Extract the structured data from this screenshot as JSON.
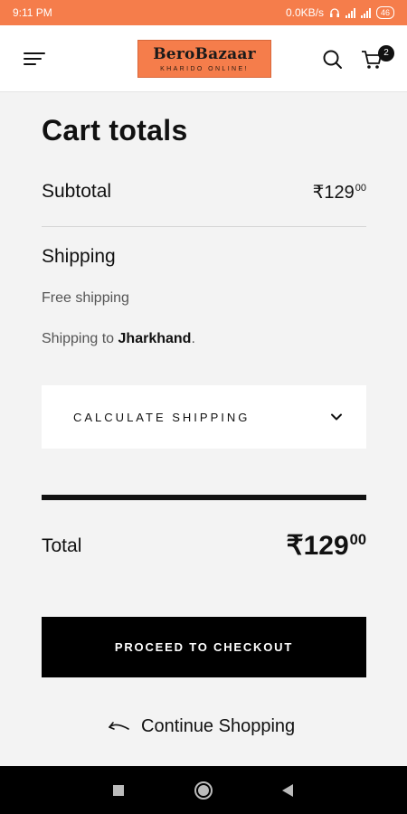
{
  "status_bar": {
    "time": "9:11 PM",
    "network_speed": "0.0KB/s",
    "battery": "46"
  },
  "header": {
    "logo_title": "BeroBazaar",
    "logo_subtitle": "KHARIDO ONLINE!",
    "cart_count": "2",
    "icons": [
      "menu-icon",
      "search-icon",
      "cart-icon"
    ],
    "brand_color": "#f57d4b"
  },
  "cart_totals": {
    "title": "Cart totals",
    "subtotal_label": "Subtotal",
    "subtotal_currency": "₹",
    "subtotal_amount": "129",
    "subtotal_decimals": "00",
    "shipping_label": "Shipping",
    "free_shipping": "Free shipping",
    "shipping_to_prefix": "Shipping to ",
    "shipping_to_state": "Jharkhand",
    "shipping_to_suffix": ".",
    "calculate_shipping_label": "CALCULATE SHIPPING",
    "total_label": "Total",
    "total_currency": "₹",
    "total_amount": "129",
    "total_decimals": "00",
    "checkout_label": "PROCEED TO CHECKOUT",
    "continue_label": "Continue Shopping"
  },
  "nav_bar": {
    "buttons": [
      "recents-icon",
      "home-icon",
      "back-icon"
    ]
  }
}
